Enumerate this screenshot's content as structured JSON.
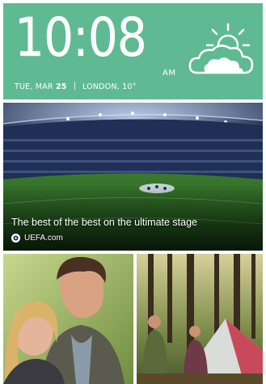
{
  "clock": {
    "time": "10:08",
    "ampm": "AM",
    "day": "TUE, MAR",
    "date": "25",
    "location_temp": "LONDON, 10°"
  },
  "weather": {
    "icon": "partly-cloudy-icon"
  },
  "story": {
    "headline": "The best of the best on the ultimate stage",
    "source": "UEFA.com"
  },
  "photos": [
    {
      "name": "couple-photo"
    },
    {
      "name": "camping-photo"
    }
  ],
  "colors": {
    "clock_background": "#5fba93",
    "text": "#ffffff"
  }
}
